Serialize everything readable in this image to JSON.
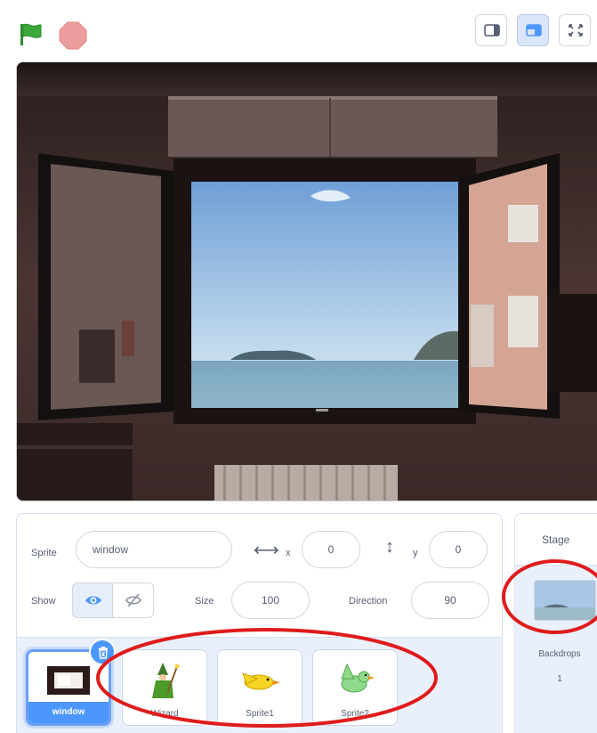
{
  "toolbar": {
    "flag_icon": "green-flag-icon",
    "stop_icon": "stop-sign-icon",
    "mode_buttons": [
      {
        "icon": "small-stage-icon",
        "active": false
      },
      {
        "icon": "normal-stage-icon",
        "active": true
      },
      {
        "icon": "fullscreen-icon",
        "active": false
      }
    ]
  },
  "colors": {
    "accent": "#4c97ff",
    "annotation": "#e01b1b",
    "flag": "#2e8b2e",
    "stop": "#ec9c9c"
  },
  "sprite_info": {
    "sprite_label": "Sprite",
    "sprite_name": "window",
    "x_label": "x",
    "x_value": "0",
    "y_label": "y",
    "y_value": "0",
    "show_label": "Show",
    "size_label": "Size",
    "size_value": "100",
    "direction_label": "Direction",
    "direction_value": "90"
  },
  "sprites": [
    {
      "name": "window",
      "selected": true
    },
    {
      "name": "Wizard",
      "selected": false
    },
    {
      "name": "Sprite1",
      "selected": false
    },
    {
      "name": "Sprite2",
      "selected": false
    }
  ],
  "stage_panel": {
    "title": "Stage",
    "backdrops_label": "Backdrops",
    "backdrops_count": "1"
  }
}
